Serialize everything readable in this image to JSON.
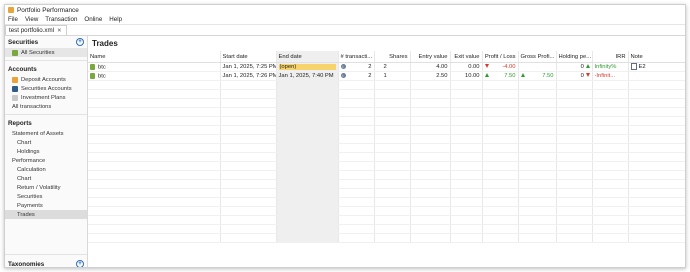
{
  "window": {
    "title": "Portfolio Performance"
  },
  "menu": [
    "File",
    "View",
    "Transaction",
    "Online",
    "Help"
  ],
  "tab": {
    "label": "test portfolio.xml"
  },
  "sidebar": {
    "securities_header": "Securities",
    "securities_items": [
      "All Securities"
    ],
    "accounts_header": "Accounts",
    "accounts_items": [
      {
        "label": "Deposit Accounts",
        "color": "#e8a33a"
      },
      {
        "label": "Securities Accounts",
        "color": "#2f5d8a"
      },
      {
        "label": "Investment Plans",
        "color": "#c9c9c9"
      }
    ],
    "all_transactions": "All transactions",
    "reports_header": "Reports",
    "reports_items": [
      {
        "label": "Statement of Assets",
        "level": 1
      },
      {
        "label": "Chart",
        "level": 2
      },
      {
        "label": "Holdings",
        "level": 2
      },
      {
        "label": "Performance",
        "level": 1
      },
      {
        "label": "Calculation",
        "level": 2
      },
      {
        "label": "Chart",
        "level": 2
      },
      {
        "label": "Return / Volatility",
        "level": 2
      },
      {
        "label": "Securities",
        "level": 2
      },
      {
        "label": "Payments",
        "level": 2
      },
      {
        "label": "Trades",
        "level": 2,
        "selected": true
      }
    ],
    "taxonomies_header": "Taxonomies"
  },
  "main": {
    "title": "Trades",
    "columns": [
      "Name",
      "Start date",
      "End date",
      "# transacti...",
      "Shares",
      "Entry value",
      "Exit value",
      "Profit / Loss",
      "Gross Profi...",
      "Holding pe...",
      "IRR",
      "Note"
    ],
    "rows": [
      {
        "name": "btc",
        "start": "Jan 1, 2025, 7:25 PM",
        "end": "(open)",
        "tx": "2",
        "shares": "2",
        "entry": "4.00",
        "exit": "0.00",
        "pl": "-4.00",
        "pl_dir": "down",
        "gross": "",
        "gross_dir": "",
        "holding": "0",
        "holding_dir": "up",
        "irr": "Infinity%",
        "irr_dir": "up",
        "note": "E2"
      },
      {
        "name": "btc",
        "start": "Jan 1, 2025, 7:26 PM",
        "end": "Jan 1, 2025, 7:40 PM",
        "tx": "2",
        "shares": "1",
        "entry": "2.50",
        "exit": "10.00",
        "pl": "7.50",
        "pl_dir": "up",
        "gross": "7.50",
        "gross_dir": "up",
        "holding": "0",
        "holding_dir": "down",
        "irr": "-Infinit...",
        "irr_dir": "down",
        "note": ""
      }
    ]
  }
}
